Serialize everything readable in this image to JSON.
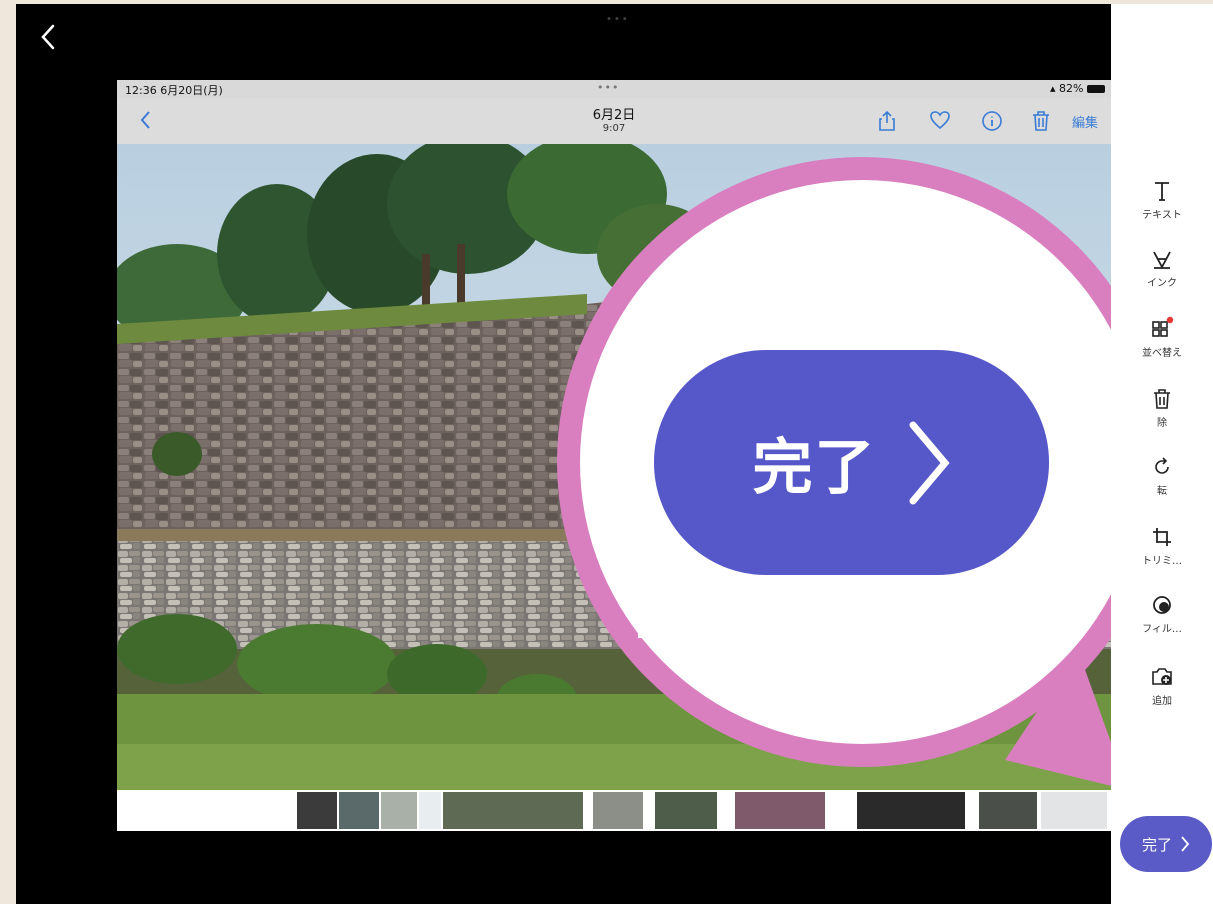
{
  "outer": {
    "dots": "•••"
  },
  "screenshot": {
    "status": {
      "time": "12:36  6月20日(月)",
      "dots": "•••",
      "battery": "82%"
    },
    "nav": {
      "date": "6月2日",
      "time": "9:07",
      "edit": "編集"
    }
  },
  "tools": [
    {
      "label": "テキスト",
      "icon": "text-icon"
    },
    {
      "label": "インク",
      "icon": "ink-pen-icon"
    },
    {
      "label": "並べ替え",
      "icon": "reorder-icon"
    },
    {
      "label": "除",
      "icon": "delete-icon"
    },
    {
      "label": "転",
      "icon": "rotate-icon"
    },
    {
      "label": "トリミ…",
      "icon": "crop-icon"
    },
    {
      "label": "フィル…",
      "icon": "filter-icon"
    },
    {
      "label": "追加",
      "icon": "add-photo-icon"
    }
  ],
  "done_button": {
    "label": "完了"
  },
  "zoom": {
    "label": "完了"
  },
  "colors": {
    "accent": "#5a5bc7",
    "callout": "#d97fbf"
  }
}
